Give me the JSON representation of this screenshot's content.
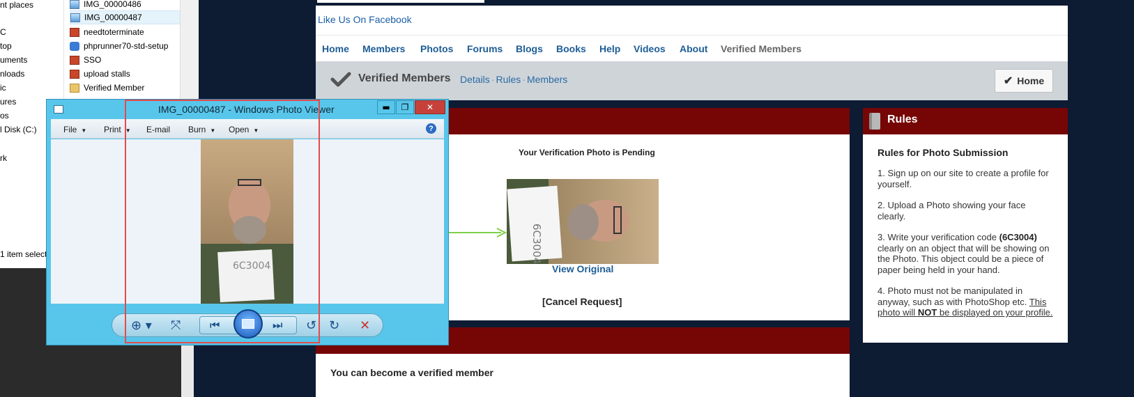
{
  "explorer": {
    "nav_items": [
      "nt places",
      "C",
      "top",
      "uments",
      "nloads",
      "ic",
      "ures",
      "os",
      "l Disk (C:)",
      "rk"
    ],
    "files": [
      {
        "name": "IMG_00000486",
        "icon": "image-file-icon"
      },
      {
        "name": "IMG_00000487",
        "icon": "image-file-icon"
      },
      {
        "name": "needtoterminate",
        "icon": "document-file-icon"
      },
      {
        "name": "phprunner70-std-setup",
        "icon": "setup-file-icon"
      },
      {
        "name": "SSO",
        "icon": "document-file-icon"
      },
      {
        "name": "upload stalls",
        "icon": "document-file-icon"
      },
      {
        "name": "Verified Member",
        "icon": "zip-folder-icon"
      }
    ],
    "status": "1 item select"
  },
  "photo_viewer": {
    "title": "IMG_00000487 - Windows Photo Viewer",
    "menu": [
      "File",
      "Print",
      "E-mail",
      "Burn",
      "Open"
    ],
    "help_glyph": "?",
    "window_buttons": {
      "minimize": "▬",
      "maximize": "❐",
      "close": "✕"
    },
    "controls": {
      "zoom": "⊕ ▾",
      "fit": "⤧",
      "prev": "⏮",
      "next": "⏭",
      "rotate_ccw": "↺",
      "rotate_cw": "↻",
      "delete": "✕"
    }
  },
  "web": {
    "facebook_link": "Like Us On Facebook",
    "nav": [
      "Home",
      "Members",
      "Photos",
      "Forums",
      "Blogs",
      "Books",
      "Help",
      "Videos",
      "About",
      "Verified Members"
    ],
    "subnav": {
      "title": "Verified Members",
      "links": [
        "Details",
        "Rules",
        "Members"
      ],
      "home_button": "Home"
    },
    "main": {
      "pending_title": "Your Verification Photo is Pending",
      "view_original": "View Original",
      "cancel_request": "[Cancel Request]",
      "become_text": "You can become a verified member"
    },
    "rules": {
      "title": "Rules",
      "heading": "Rules for Photo Submission",
      "r1": "1. Sign up on our site to create a profile for yourself.",
      "r2": "2. Upload a Photo showing your face clearly.",
      "r3a": "3. Write your verification code ",
      "r3code": "(6C3004)",
      "r3b": " clearly on an object that will be showing on the Photo. This object could be a piece of paper being held in your hand.",
      "r4a": "4. Photo must not be manipulated in anyway, such as with PhotoShop etc. ",
      "r4u1": "This photo will ",
      "r4not": "NOT",
      "r4u2": " be displayed on your profile."
    },
    "photo_note_code": "6C3004"
  },
  "colors": {
    "panel_header": "#760606",
    "link_blue": "#1d5d96",
    "viewer_frame": "#58c6ea",
    "highlight": "#e64a4a",
    "arrow": "#7ed04b"
  }
}
